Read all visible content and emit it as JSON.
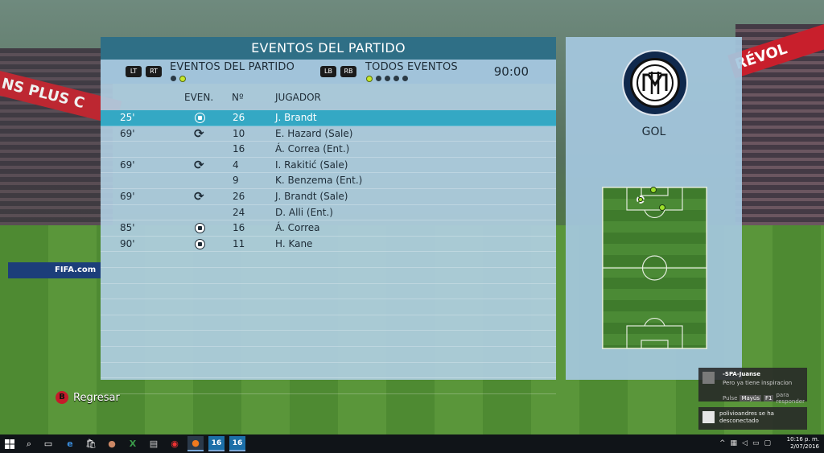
{
  "background": {
    "left_banner": "NS PLUS C",
    "right_banner": "RÉVOL",
    "board_text": "FIFA.com"
  },
  "events_panel": {
    "title": "EVENTOS DEL PARTIDO",
    "filters": {
      "left_buttons": [
        "LT",
        "RT"
      ],
      "left_label": "EVENTOS DEL PARTIDO",
      "right_buttons": [
        "LB",
        "RB"
      ],
      "right_label": "TODOS EVENTOS"
    },
    "match_time": "90:00",
    "columns": {
      "event": "EVEN.",
      "number": "Nº",
      "player": "JUGADOR"
    },
    "rows": [
      {
        "minute": "25'",
        "icon": "ball-icon",
        "number": "26",
        "player": "J. Brandt",
        "selected": true
      },
      {
        "minute": "69'",
        "icon": "substitution-icon",
        "number": "10",
        "player": "E. Hazard (Sale)"
      },
      {
        "minute": "",
        "icon": "",
        "number": "16",
        "player": "Á. Correa (Ent.)"
      },
      {
        "minute": "69'",
        "icon": "substitution-icon",
        "number": "4",
        "player": "I. Rakitić (Sale)"
      },
      {
        "minute": "",
        "icon": "",
        "number": "9",
        "player": "K. Benzema (Ent.)"
      },
      {
        "minute": "69'",
        "icon": "substitution-icon",
        "number": "26",
        "player": "J. Brandt (Sale)"
      },
      {
        "minute": "",
        "icon": "",
        "number": "24",
        "player": "D. Alli (Ent.)"
      },
      {
        "minute": "85'",
        "icon": "ball-icon",
        "number": "16",
        "player": "Á. Correa"
      },
      {
        "minute": "90'",
        "icon": "ball-icon",
        "number": "11",
        "player": "H. Kane"
      }
    ]
  },
  "detail_panel": {
    "event_type": "GOL",
    "crest_letters": "FCIM"
  },
  "back_hint": {
    "button": "B",
    "label": "Regresar"
  },
  "notifications": [
    {
      "name": "-SPA-Juanse",
      "message": "Pero ya tiene inspiracion",
      "hint_prefix": "Pulse",
      "key1": "Mayús",
      "key2": "F1",
      "hint_suffix": "para responder"
    },
    {
      "message": "polivioandres se ha desconectado"
    }
  ],
  "taskbar": {
    "clock_time": "10:16 p. m.",
    "clock_date": "2/07/2016",
    "app_badge_1": "16",
    "app_badge_2": "16"
  }
}
